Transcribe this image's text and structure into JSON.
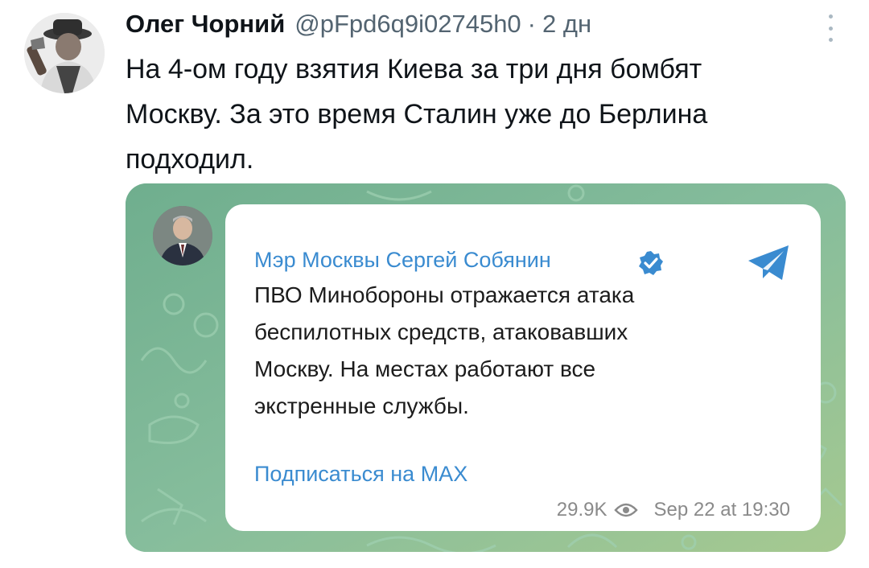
{
  "tweet": {
    "author_name": "Олег Чорний",
    "handle": "@pFpd6q9i02745h0",
    "separator": "·",
    "time": "2 дн",
    "text": "На 4-ом году взятия Киева за три дня бомбят\nМоскву. За это время Сталин уже до Берлина\nподходил."
  },
  "embed": {
    "channel_name": "Мэр Москвы Сергей Собянин",
    "message": "ПВО Минобороны отражается атака\nбеспилотных средств, атаковавших\nМоскву. На местах работают все\nэкстренные службы.",
    "subscribe_label": "Подписаться на МАХ",
    "views": "29.9K",
    "timestamp": "Sep 22 at 19:30"
  },
  "colors": {
    "link_blue": "#3a8bd0",
    "telegram_bg": "#7db79b",
    "muted": "#536471"
  },
  "icons": [
    "avatar",
    "more-vertical-icon",
    "verified-badge-icon",
    "telegram-icon",
    "eye-icon"
  ]
}
